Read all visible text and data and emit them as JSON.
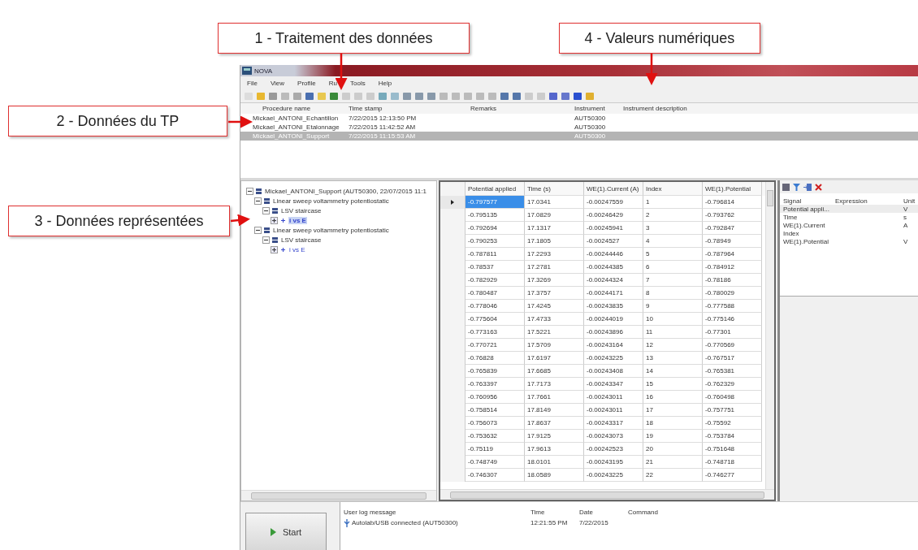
{
  "callouts": [
    {
      "label": "1 - Traitement des données"
    },
    {
      "label": "4 - Valeurs numériques"
    },
    {
      "label": "2 - Données du TP"
    },
    {
      "label": "3 - Données représentées"
    }
  ],
  "window": {
    "title": "NOVA",
    "menu": [
      "File",
      "View",
      "Profile",
      "Ru",
      "Tools",
      "Help"
    ]
  },
  "procedures": {
    "columns": [
      "Procedure name",
      "Time stamp",
      "Remarks",
      "Instrument",
      "Instrument description"
    ],
    "rows": [
      {
        "name": "Mickael_ANTONI_Echantillon",
        "time_stamp": "7/22/2015 12:13:50 PM",
        "instrument": "AUT50300",
        "selected": false
      },
      {
        "name": "Mickael_ANTONI_Etalonnage",
        "time_stamp": "7/22/2015 11:42:52 AM",
        "instrument": "AUT50300",
        "selected": false
      },
      {
        "name": "Mickael_ANTONI_Support",
        "time_stamp": "7/22/2015 11:15:53 AM",
        "instrument": "AUT50300",
        "selected": true
      }
    ]
  },
  "tree": [
    {
      "label": "Mickael_ANTONI_Support (AUT50300, 22/07/2015 11:1",
      "expanded": true,
      "children": [
        {
          "label": "Linear sweep voltammetry potentiostatic",
          "expanded": true,
          "children": [
            {
              "label": "LSV staircase",
              "expanded": true,
              "children": [
                {
                  "label": "i vs E",
                  "expanded": false,
                  "selected": true
                }
              ]
            }
          ]
        },
        {
          "label": "Linear sweep voltammetry potentiostatic",
          "expanded": true,
          "children": [
            {
              "label": "LSV staircase",
              "expanded": true,
              "children": [
                {
                  "label": "i vs E",
                  "expanded": false,
                  "selected": false
                }
              ]
            }
          ]
        }
      ]
    }
  ],
  "data_table": {
    "columns": [
      "Potential applied",
      "Time (s)",
      "WE(1).Current (A)",
      "Index",
      "WE(1).Potential"
    ],
    "rows": [
      {
        "selected": true,
        "cells": [
          "-0.797577",
          "17.0341",
          "-0.00247559",
          "1",
          "-0.796814"
        ]
      },
      {
        "selected": false,
        "cells": [
          "-0.795135",
          "17.0829",
          "-0.00246429",
          "2",
          "-0.793762"
        ]
      },
      {
        "selected": false,
        "cells": [
          "-0.792694",
          "17.1317",
          "-0.00245941",
          "3",
          "-0.792847"
        ]
      },
      {
        "selected": false,
        "cells": [
          "-0.790253",
          "17.1805",
          "-0.0024527",
          "4",
          "-0.78949"
        ]
      },
      {
        "selected": false,
        "cells": [
          "-0.787811",
          "17.2293",
          "-0.00244446",
          "5",
          "-0.787964"
        ]
      },
      {
        "selected": false,
        "cells": [
          "-0.78537",
          "17.2781",
          "-0.00244385",
          "6",
          "-0.784912"
        ]
      },
      {
        "selected": false,
        "cells": [
          "-0.782929",
          "17.3269",
          "-0.00244324",
          "7",
          "-0.78186"
        ]
      },
      {
        "selected": false,
        "cells": [
          "-0.780487",
          "17.3757",
          "-0.00244171",
          "8",
          "-0.780029"
        ]
      },
      {
        "selected": false,
        "cells": [
          "-0.778046",
          "17.4245",
          "-0.00243835",
          "9",
          "-0.777588"
        ]
      },
      {
        "selected": false,
        "cells": [
          "-0.775604",
          "17.4733",
          "-0.00244019",
          "10",
          "-0.775146"
        ]
      },
      {
        "selected": false,
        "cells": [
          "-0.773163",
          "17.5221",
          "-0.00243896",
          "11",
          "-0.77301"
        ]
      },
      {
        "selected": false,
        "cells": [
          "-0.770721",
          "17.5709",
          "-0.00243164",
          "12",
          "-0.770569"
        ]
      },
      {
        "selected": false,
        "cells": [
          "-0.76828",
          "17.6197",
          "-0.00243225",
          "13",
          "-0.767517"
        ]
      },
      {
        "selected": false,
        "cells": [
          "-0.765839",
          "17.6685",
          "-0.00243408",
          "14",
          "-0.765381"
        ]
      },
      {
        "selected": false,
        "cells": [
          "-0.763397",
          "17.7173",
          "-0.00243347",
          "15",
          "-0.762329"
        ]
      },
      {
        "selected": false,
        "cells": [
          "-0.760956",
          "17.7661",
          "-0.00243011",
          "16",
          "-0.760498"
        ]
      },
      {
        "selected": false,
        "cells": [
          "-0.758514",
          "17.8149",
          "-0.00243011",
          "17",
          "-0.757751"
        ]
      },
      {
        "selected": false,
        "cells": [
          "-0.756073",
          "17.8637",
          "-0.00243317",
          "18",
          "-0.75592"
        ]
      },
      {
        "selected": false,
        "cells": [
          "-0.753632",
          "17.9125",
          "-0.00243073",
          "19",
          "-0.753784"
        ]
      },
      {
        "selected": false,
        "cells": [
          "-0.75119",
          "17.9613",
          "-0.00242523",
          "20",
          "-0.751648"
        ]
      },
      {
        "selected": false,
        "cells": [
          "-0.748749",
          "18.0101",
          "-0.00243195",
          "21",
          "-0.748718"
        ]
      },
      {
        "selected": false,
        "cells": [
          "-0.746307",
          "18.0589",
          "-0.00243225",
          "22",
          "-0.746277"
        ]
      }
    ]
  },
  "signals": {
    "columns": [
      "Signal",
      "Expression",
      "Unit"
    ],
    "rows": [
      {
        "signal": "Potential appli...",
        "unit": "V"
      },
      {
        "signal": "Time",
        "unit": "s"
      },
      {
        "signal": "WE(1).Current",
        "unit": "A"
      },
      {
        "signal": "Index"
      },
      {
        "signal": "WE(1).Potential",
        "unit": "V"
      }
    ]
  },
  "start_button": "Start",
  "log": {
    "columns": [
      "User log message",
      "Time",
      "Date",
      "Command"
    ],
    "rows": [
      {
        "message": "Autolab/USB connected (AUT50300)",
        "time": "12:21:55 PM",
        "date": "7/22/2015"
      }
    ]
  }
}
